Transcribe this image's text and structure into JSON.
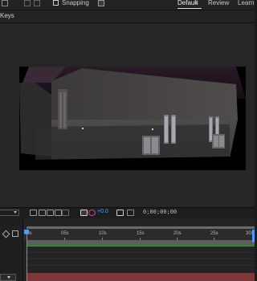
{
  "toolbar": {
    "snapping_label": "Snapping",
    "workspaces": [
      {
        "label": "Default",
        "active": true
      },
      {
        "label": "Review",
        "active": false
      },
      {
        "label": "Learn",
        "active": false
      }
    ],
    "menu_glyph": "≡"
  },
  "panel": {
    "tab_label": "Keys"
  },
  "timeline_controls": {
    "exposure_value": "+0.0",
    "timecode": "0;00;00;00"
  },
  "timeline": {
    "ruler_ticks": [
      "00s",
      "05s",
      "10s",
      "15s",
      "20s",
      "25s",
      "30s"
    ],
    "accent_color": "#4a9bff",
    "track_color": "#7a3838"
  },
  "icons": [
    "select-icon",
    "snapping-checkbox",
    "menu-icon",
    "camera-icon",
    "color-wheel-icon",
    "region-icon",
    "grid-icon",
    "playhead-icon"
  ]
}
